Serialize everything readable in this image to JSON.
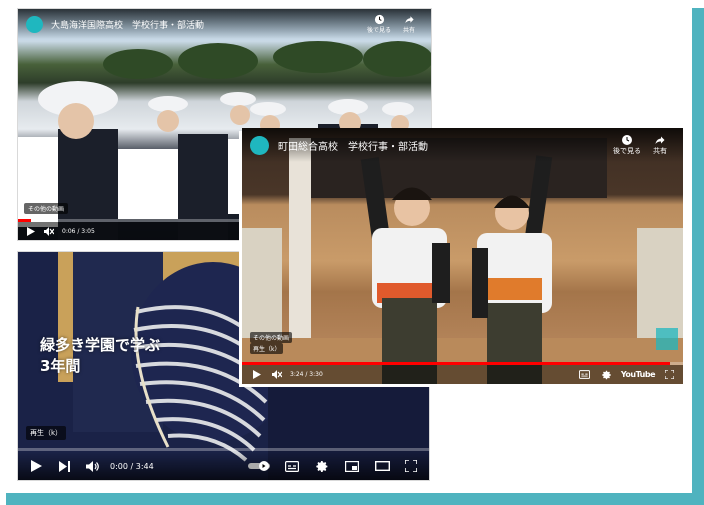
{
  "players": {
    "p1": {
      "title": "大島海洋国際高校　学校行事・部活動",
      "watch_later": "後で見る",
      "share": "共有",
      "tag": "その他の動画",
      "time": "0:06 / 3:05",
      "progress_fraction": 0.032
    },
    "p2": {
      "tag": "再生（k）",
      "overlay_line1": "緑多き学園で学ぶ",
      "overlay_line2": "3年間",
      "time": "0:00 / 3:44",
      "progress_fraction": 0.0
    },
    "p3": {
      "title": "町田総合高校　学校行事・部活動",
      "watch_later": "後で見る",
      "share": "共有",
      "tag_more": "その他の動画",
      "tag_play": "再生（k）",
      "time": "3:24 / 3:30",
      "progress_fraction": 0.971,
      "youtube_label": "YouTube"
    }
  },
  "colors": {
    "frame_accent": "#4fb3bf",
    "progress": "#ff0000",
    "channel_logo": "#1fb7bf"
  }
}
